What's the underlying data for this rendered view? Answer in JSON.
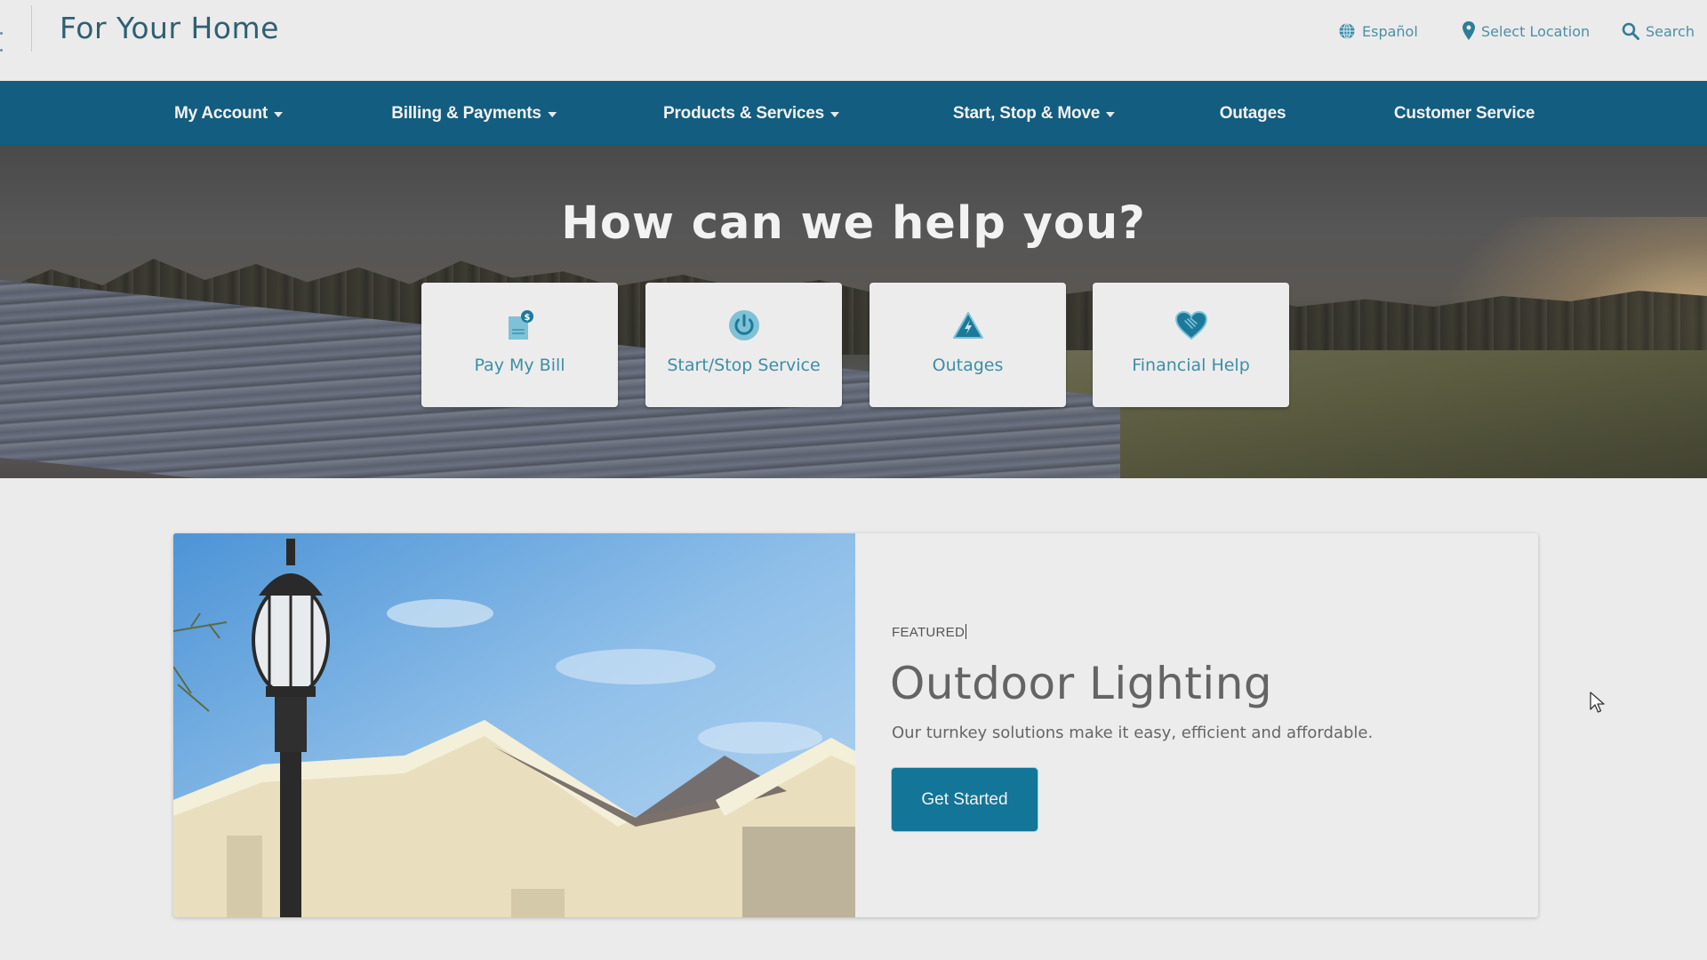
{
  "header": {
    "site_title": "For Your Home",
    "utility_links": [
      {
        "label": "Español",
        "icon": "globe-icon"
      },
      {
        "label": "Select Location",
        "icon": "map-pin-icon"
      },
      {
        "label": "Search",
        "icon": "search-icon"
      }
    ]
  },
  "nav": {
    "items": [
      {
        "label": "My Account",
        "has_dropdown": true
      },
      {
        "label": "Billing & Payments",
        "has_dropdown": true
      },
      {
        "label": "Products & Services",
        "has_dropdown": true
      },
      {
        "label": "Start, Stop & Move",
        "has_dropdown": true
      },
      {
        "label": "Outages",
        "has_dropdown": false
      },
      {
        "label": "Customer Service",
        "has_dropdown": false
      }
    ]
  },
  "hero": {
    "title": "How can we help you?",
    "quick_links": [
      {
        "label": "Pay My Bill",
        "icon": "bill-dollar-icon"
      },
      {
        "label": "Start/Stop Service",
        "icon": "power-icon"
      },
      {
        "label": "Outages",
        "icon": "lightning-warning-icon"
      },
      {
        "label": "Financial Help",
        "icon": "heart-hands-icon"
      }
    ]
  },
  "featured": {
    "label": "FEATURED",
    "title": "Outdoor Lighting",
    "description": "Our turnkey solutions make it easy, efficient and affordable.",
    "button_label": "Get Started",
    "image_alt": "Street lamp in front of a house"
  },
  "colors": {
    "brand_nav": "#125d80",
    "accent_teal": "#3b8fa6",
    "button": "#137597",
    "page_bg": "#ebebeb"
  }
}
